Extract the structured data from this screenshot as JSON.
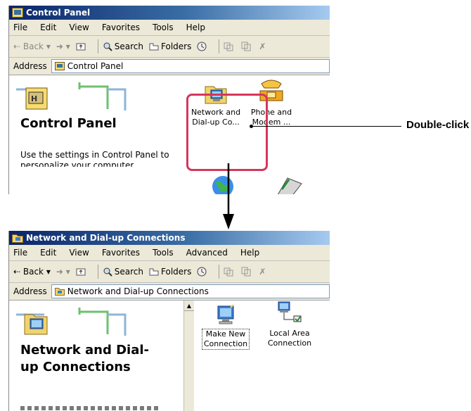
{
  "window1": {
    "title": "Control Panel",
    "menu": [
      "File",
      "Edit",
      "View",
      "Favorites",
      "Tools",
      "Help"
    ],
    "toolbar": {
      "back": "Back",
      "search": "Search",
      "folders": "Folders"
    },
    "address_label": "Address",
    "address_value": "Control Panel",
    "pane_title": "Control Panel",
    "pane_text_1": "Use the settings in Control Panel to",
    "pane_text_2": "personalize your computer",
    "icons": [
      {
        "line1": "Network and",
        "line2": "Dial-up Co..."
      },
      {
        "line1": "Phone and",
        "line2": "Modem ..."
      }
    ]
  },
  "callout": {
    "text": "Double-click"
  },
  "window2": {
    "title": "Network and Dial-up Connections",
    "menu": [
      "File",
      "Edit",
      "View",
      "Favorites",
      "Tools",
      "Advanced",
      "Help"
    ],
    "toolbar": {
      "back": "Back",
      "search": "Search",
      "folders": "Folders"
    },
    "address_label": "Address",
    "address_value": "Network and Dial-up Connections",
    "pane_title_1": "Network and Dial-",
    "pane_title_2": "up Connections",
    "icons": [
      {
        "line1": "Make New",
        "line2": "Connection"
      },
      {
        "line1": "Local Area",
        "line2": "Connection"
      }
    ]
  },
  "colors": {
    "title_start": "#0a246a",
    "title_end": "#a6caf0",
    "highlight": "#d6365c"
  }
}
